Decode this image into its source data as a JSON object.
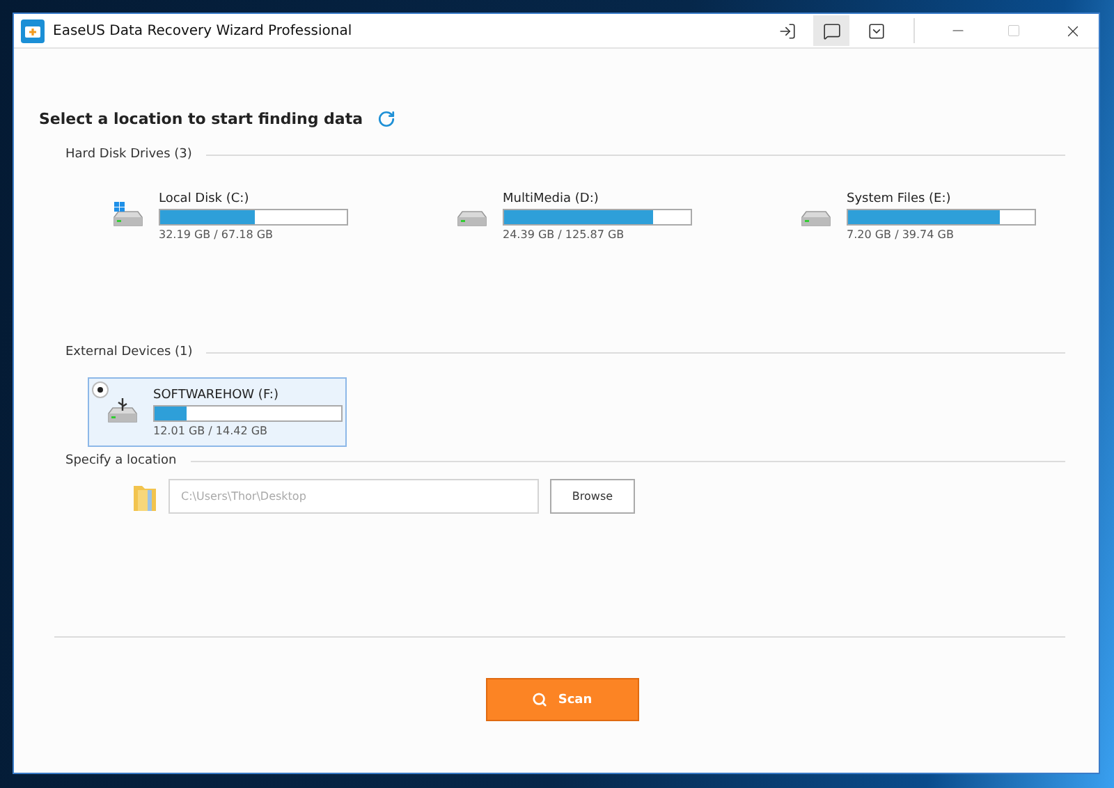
{
  "window": {
    "title": "EaseUS Data Recovery Wizard Professional"
  },
  "heading": "Select a location to start finding data",
  "sections": [
    {
      "title": "Hard Disk Drives (3)",
      "drives": [
        {
          "kind": "system",
          "name": "Local Disk (C:)",
          "level": 0.51,
          "size": "32.19 GB / 67.18 GB",
          "selected": false
        },
        {
          "kind": "disk",
          "name": "MultiMedia (D:)",
          "level": 0.8,
          "size": "24.39 GB / 125.87 GB",
          "selected": false
        },
        {
          "kind": "disk",
          "name": "System Files (E:)",
          "level": 0.81,
          "size": "7.20 GB / 39.74 GB",
          "selected": false
        }
      ]
    },
    {
      "title": "External Devices (1)",
      "drives": [
        {
          "kind": "usb",
          "name": "SOFTWAREHOW (F:)",
          "level": 0.17,
          "size": "12.01 GB / 14.42 GB",
          "selected": true
        }
      ]
    }
  ],
  "location": {
    "title": "Specify a location",
    "placeholder": "C:\\Users\\Thor\\Desktop",
    "button": "Browse"
  },
  "scan_button": "Scan"
}
